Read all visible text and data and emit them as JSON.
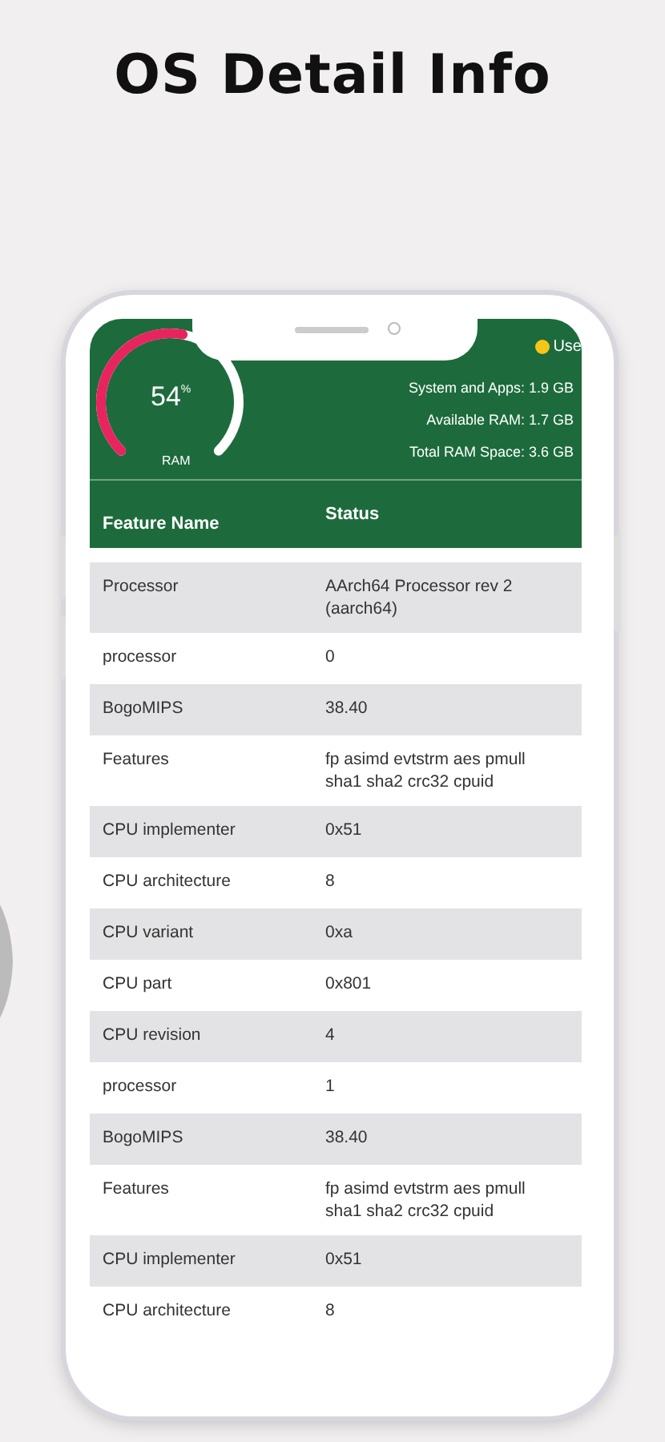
{
  "title": "OS Detail Info",
  "ram": {
    "percent": "54",
    "percent_sign": "%",
    "label": "RAM",
    "legend": {
      "label": "Use",
      "color": "#f5c518"
    },
    "stats": [
      {
        "label": "System and Apps:",
        "value": "1.9 GB"
      },
      {
        "label": "Available RAM:",
        "value": "1.7 GB"
      },
      {
        "label": "Total RAM Space:",
        "value": "3.6 GB"
      }
    ]
  },
  "table": {
    "columns": [
      "Feature Name",
      "Status"
    ],
    "rows": [
      [
        "Processor",
        "AArch64 Processor rev 2 (aarch64)"
      ],
      [
        "processor",
        "0"
      ],
      [
        "BogoMIPS",
        "38.40"
      ],
      [
        "Features",
        "fp asimd evtstrm aes pmull sha1 sha2 crc32 cpuid"
      ],
      [
        "CPU implementer",
        "0x51"
      ],
      [
        "CPU architecture",
        "8"
      ],
      [
        "CPU variant",
        "0xa"
      ],
      [
        "CPU part",
        "0x801"
      ],
      [
        "CPU revision",
        "4"
      ],
      [
        "processor",
        "1"
      ],
      [
        "BogoMIPS",
        "38.40"
      ],
      [
        "Features",
        "fp asimd evtstrm aes pmull sha1 sha2 crc32 cpuid"
      ],
      [
        "CPU implementer",
        "0x51"
      ],
      [
        "CPU architecture",
        "8"
      ]
    ]
  }
}
